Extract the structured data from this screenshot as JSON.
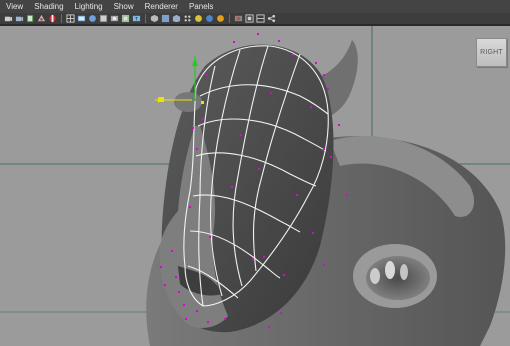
{
  "menubar": {
    "items": [
      {
        "label": "View"
      },
      {
        "label": "Shading"
      },
      {
        "label": "Lighting"
      },
      {
        "label": "Show"
      },
      {
        "label": "Renderer"
      },
      {
        "label": "Panels"
      }
    ]
  },
  "toolbar": {
    "icons": [
      "camera-select-icon",
      "camera-attributes-icon",
      "bookmark-icon",
      "image-plane-icon",
      "resolution-gate-icon",
      "grid-icon",
      "wireframe-icon",
      "smooth-shade-icon",
      "textured-icon",
      "lights-icon",
      "shadows-icon",
      "xray-icon",
      "isolate-select-icon",
      "render-view-icon"
    ]
  },
  "viewport": {
    "view_cube_label": "RIGHT",
    "colors": {
      "background": "#9b9b9b",
      "wireframe": "#f2f2f2",
      "cv_points": "#e000e0",
      "manipulator": "#e6e600",
      "axis_y": "#22cc22",
      "grid_line": "#2e5a5a"
    }
  }
}
